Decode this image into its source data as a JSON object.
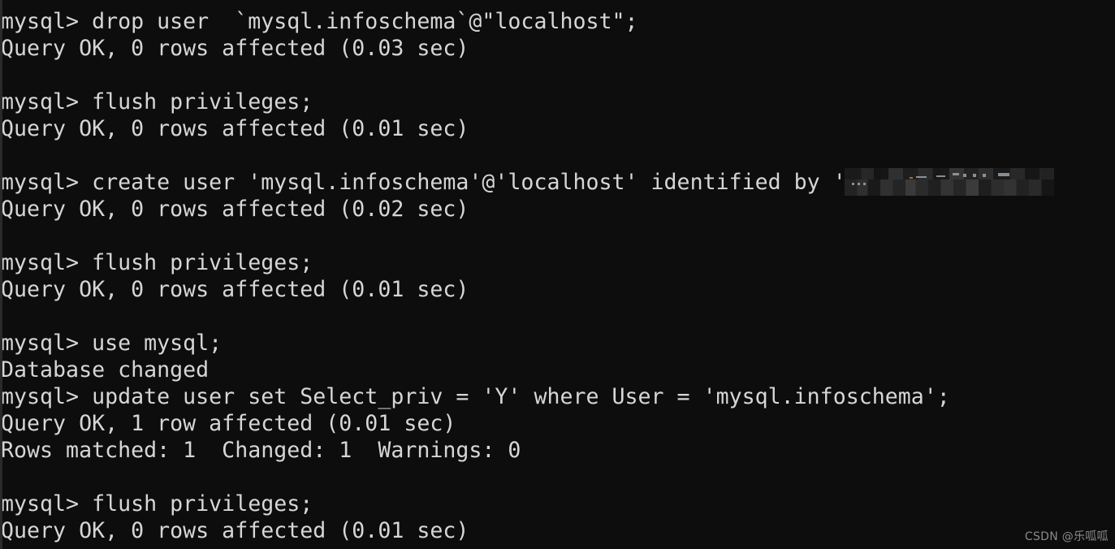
{
  "terminal": {
    "background_color": "#0d0d0d",
    "text_color": "#d6d6d6",
    "prompt": "mysql>",
    "lines": [
      {
        "text": "mysql> drop user  `mysql.infoschema`@\"localhost\";"
      },
      {
        "text": "Query OK, 0 rows affected (0.03 sec)"
      },
      {
        "text": ""
      },
      {
        "text": "mysql> flush privileges;"
      },
      {
        "text": "Query OK, 0 rows affected (0.01 sec)"
      },
      {
        "text": ""
      },
      {
        "text": "mysql> create user 'mysql.infoschema'@'localhost' identified by '            ';"
      },
      {
        "text": "Query OK, 0 rows affected (0.02 sec)"
      },
      {
        "text": ""
      },
      {
        "text": "mysql> flush privileges;"
      },
      {
        "text": "Query OK, 0 rows affected (0.01 sec)"
      },
      {
        "text": ""
      },
      {
        "text": "mysql> use mysql;"
      },
      {
        "text": "Database changed"
      },
      {
        "text": "mysql> update user set Select_priv = 'Y' where User = 'mysql.infoschema';"
      },
      {
        "text": "Query OK, 1 row affected (0.01 sec)"
      },
      {
        "text": "Rows matched: 1  Changed: 1  Warnings: 0"
      },
      {
        "text": ""
      },
      {
        "text": "mysql> flush privileges;"
      },
      {
        "text": "Query OK, 0 rows affected (0.01 sec)"
      }
    ]
  },
  "redaction": {
    "label": "blurred-password",
    "note": "password literal obscured by mosaic"
  },
  "watermark": {
    "text": "CSDN @乐呱呱"
  }
}
